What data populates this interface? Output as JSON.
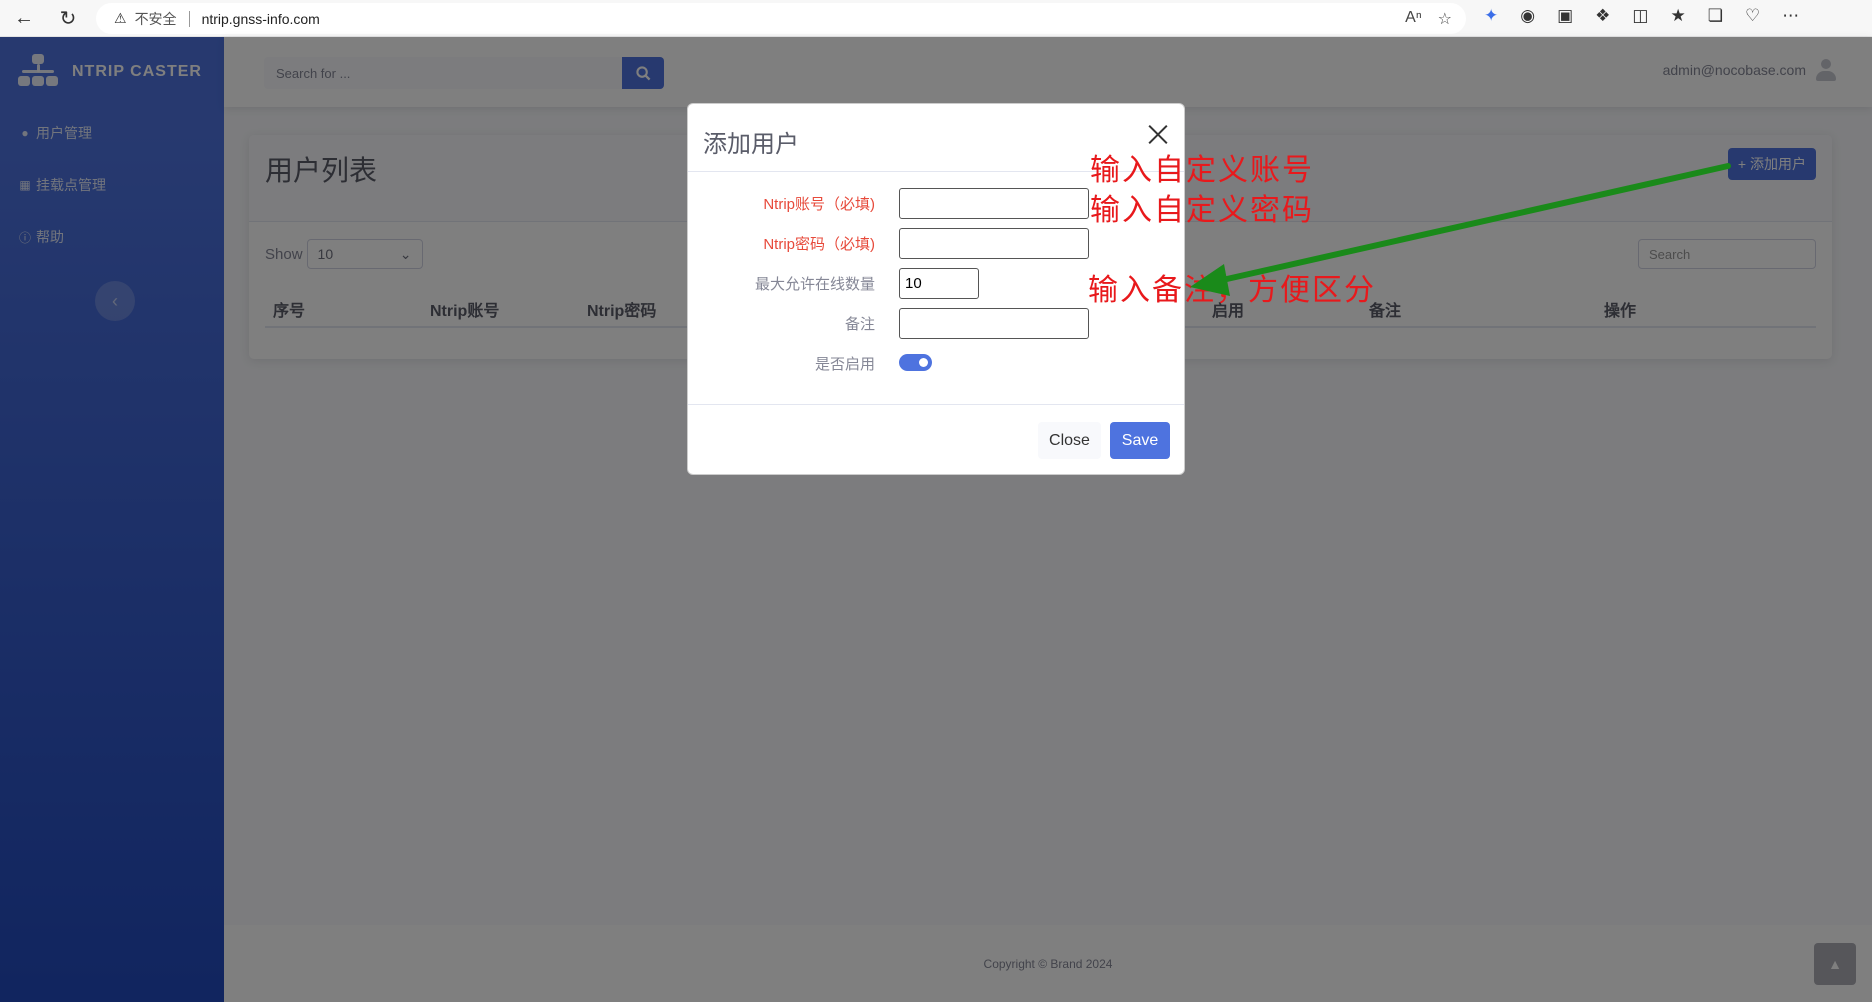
{
  "browser": {
    "security_label": "不安全",
    "url": "ntrip.gnss-info.com"
  },
  "sidebar": {
    "brand": "NTRIP CASTER",
    "items": [
      {
        "label": "用户管理",
        "icon": "user-icon"
      },
      {
        "label": "挂载点管理",
        "icon": "table-icon"
      },
      {
        "label": "帮助",
        "icon": "info-icon"
      }
    ]
  },
  "topbar": {
    "search_placeholder": "Search for ...",
    "user_email": "admin@nocobase.com"
  },
  "card": {
    "title": "用户列表",
    "add_button": "添加用户",
    "show_label": "Show",
    "show_value": "10",
    "search_placeholder": "Search",
    "columns": [
      "序号",
      "Ntrip账号",
      "Ntrip密码",
      "启用",
      "备注",
      "操作"
    ]
  },
  "footer": {
    "copyright": "Copyright © Brand 2024"
  },
  "modal": {
    "title": "添加用户",
    "fields": [
      {
        "label": "Ntrip账号（必填)",
        "value": "",
        "required": true
      },
      {
        "label": "Ntrip密码（必填)",
        "value": "",
        "required": true
      },
      {
        "label": "最大允许在线数量",
        "value": "10",
        "required": false
      },
      {
        "label": "备注",
        "value": "",
        "required": false
      },
      {
        "label": "是否启用",
        "toggle": true,
        "required": false
      }
    ],
    "close_label": "Close",
    "save_label": "Save"
  },
  "annotations": {
    "account": "输入自定义账号",
    "password": "输入自定义密码",
    "remark": "输入备注，方便区分",
    "text_color": "#e8191c",
    "arrow_color": "#1a8a1a"
  },
  "colors": {
    "primary": "#4e73df",
    "danger": "#e74a3b"
  }
}
